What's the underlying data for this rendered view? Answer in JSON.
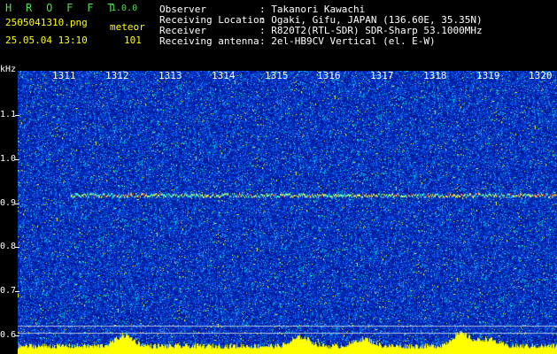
{
  "app": {
    "title": "H R O F F T",
    "version": "1.0.0"
  },
  "file": {
    "name": "2505041310.png",
    "datetime": "25.05.04 13:10"
  },
  "detection": {
    "kind": "meteor",
    "count": "101"
  },
  "info": [
    {
      "label": "Observer",
      "value": ": Takanori Kawachi"
    },
    {
      "label": "Receiving Location",
      "value": ": Ogaki, Gifu, JAPAN (136.60E, 35.35N)"
    },
    {
      "label": "Receiver",
      "value": ": R820T2(RTL-SDR) SDR-Sharp 53.1000MHz"
    },
    {
      "label": "Receiving antenna",
      "value": ": 2el-HB9CV Vertical (el. E-W)"
    }
  ],
  "axis": {
    "y_unit": "kHz",
    "y_ticks": [
      "1.1",
      "1.0",
      "0.9",
      "0.8",
      "0.7",
      "0.6"
    ],
    "x_ticks": [
      "1311",
      "1312",
      "1313",
      "1314",
      "1315",
      "1316",
      "1317",
      "1318",
      "1319",
      "1320"
    ]
  },
  "colors": {
    "header_green": "#4be04b",
    "label_yellow": "#ffff00",
    "background": "#000000"
  }
}
